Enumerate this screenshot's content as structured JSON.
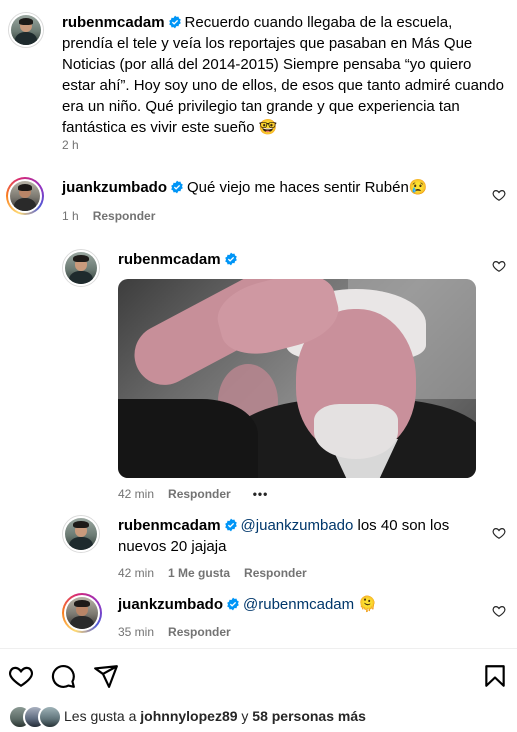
{
  "colors": {
    "verified": "#0095f6",
    "mention": "#00376b",
    "meta_text": "#737373"
  },
  "comments": [
    {
      "username": "rubenmcadam",
      "verified": true,
      "text": "Recuerdo cuando llegaba de la escuela, prendía el tele y veía los reportajes que pasaban en Más Que Noticias (por allá del 2014-2015) Siempre pensaba “yo quiero estar ahí”. Hoy soy uno de ellos, de esos que tanto admiré cuando era un niño. Qué privilegio tan grande y que experiencia tan fantástica es vivir este sueño 🤓",
      "time": "2 h"
    },
    {
      "username": "juankzumbado",
      "verified": true,
      "text": "Qué viejo me haces sentir Rubén😢",
      "time": "1 h",
      "reply_label": "Responder"
    }
  ],
  "replies": [
    {
      "username": "rubenmcadam",
      "verified": true,
      "has_gif": true,
      "time": "42 min",
      "reply_label": "Responder",
      "more_label": "•••"
    },
    {
      "username": "rubenmcadam",
      "verified": true,
      "mention": "@juankzumbado",
      "text": " los 40 son los nuevos 20 jajaja",
      "time": "42 min",
      "likes_label": "1 Me gusta",
      "reply_label": "Responder"
    },
    {
      "username": "juankzumbado",
      "verified": true,
      "mention": "@rubenmcadam",
      "text": " 🫠",
      "time": "35 min",
      "reply_label": "Responder"
    }
  ],
  "actions": {
    "like_icon": "heart-icon",
    "comment_icon": "comment-icon",
    "share_icon": "send-icon",
    "save_icon": "bookmark-icon"
  },
  "likes": {
    "prefix": "Les gusta a ",
    "user": "johnnylopez89",
    "middle": " y ",
    "others": "58 personas más"
  }
}
